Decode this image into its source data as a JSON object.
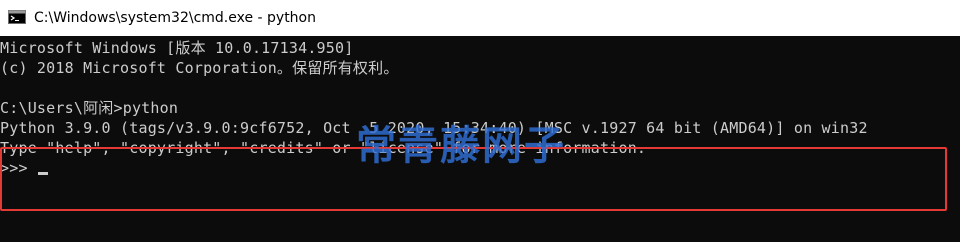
{
  "window": {
    "title": "C:\\Windows\\system32\\cmd.exe - python",
    "icon": "cmd-icon"
  },
  "console": {
    "lines": [
      "Microsoft Windows [版本 10.0.17134.950]",
      "(c) 2018 Microsoft Corporation。保留所有权利。",
      "C:\\Users\\阿闲>python",
      "Python 3.9.0 (tags/v3.9.0:9cf6752, Oct  5 2020, 15:34:40) [MSC v.1927 64 bit (AMD64)] on win32",
      "Type \"help\", \"copyright\", \"credits\" or \"license\" for more information.",
      ">>>"
    ],
    "background_color": "#0c0c0c",
    "text_color": "#cccccc"
  },
  "annotation": {
    "box_color": "#e53935"
  },
  "watermark": {
    "text": "常青藤网子",
    "color": "#2f6fd6"
  }
}
